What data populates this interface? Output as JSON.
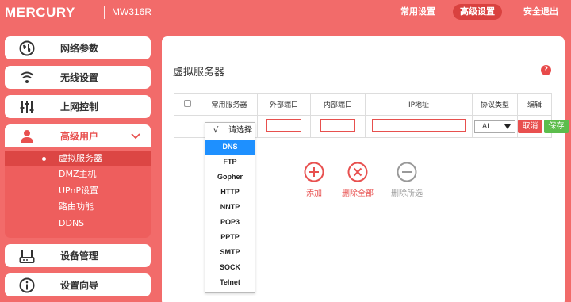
{
  "header": {
    "brand": "MERCURY",
    "model": "MW316R",
    "nav": {
      "common": "常用设置",
      "advanced": "高级设置",
      "logout": "安全退出"
    }
  },
  "sidebar": {
    "items": [
      {
        "label": "网络参数",
        "icon": "globe-icon"
      },
      {
        "label": "无线设置",
        "icon": "wifi-icon"
      },
      {
        "label": "上网控制",
        "icon": "sliders-icon"
      },
      {
        "label": "高级用户",
        "icon": "user-icon"
      },
      {
        "label": "设备管理",
        "icon": "router-icon"
      },
      {
        "label": "设置向导",
        "icon": "info-icon"
      }
    ],
    "submenu": [
      {
        "label": "虚拟服务器",
        "active": true
      },
      {
        "label": "DMZ主机"
      },
      {
        "label": "UPnP设置"
      },
      {
        "label": "路由功能"
      },
      {
        "label": "DDNS"
      }
    ]
  },
  "main": {
    "title": "虚拟服务器",
    "help": "?",
    "table": {
      "headers": [
        "常用服务器",
        "外部端口",
        "内部端口",
        "IP地址",
        "协议类型",
        "编辑"
      ],
      "new_row": {
        "service_selected": "请选择",
        "protocol": "ALL",
        "cancel_label": "取消",
        "save_label": "保存"
      }
    },
    "dropdown": {
      "check": "√",
      "head": "请选择",
      "options": [
        "DNS",
        "FTP",
        "Gopher",
        "HTTP",
        "NNTP",
        "POP3",
        "PPTP",
        "SMTP",
        "SOCK",
        "Telnet"
      ],
      "highlighted": "DNS"
    },
    "actions": {
      "add": "添加",
      "delete_all": "删除全部",
      "delete_selected": "删除所选"
    }
  },
  "colors": {
    "brand_red": "#f26b6a",
    "active_red": "#dc4644",
    "save_green": "#5cbd4c",
    "highlight_blue": "#1e90ff",
    "disabled_gray": "#999999"
  }
}
